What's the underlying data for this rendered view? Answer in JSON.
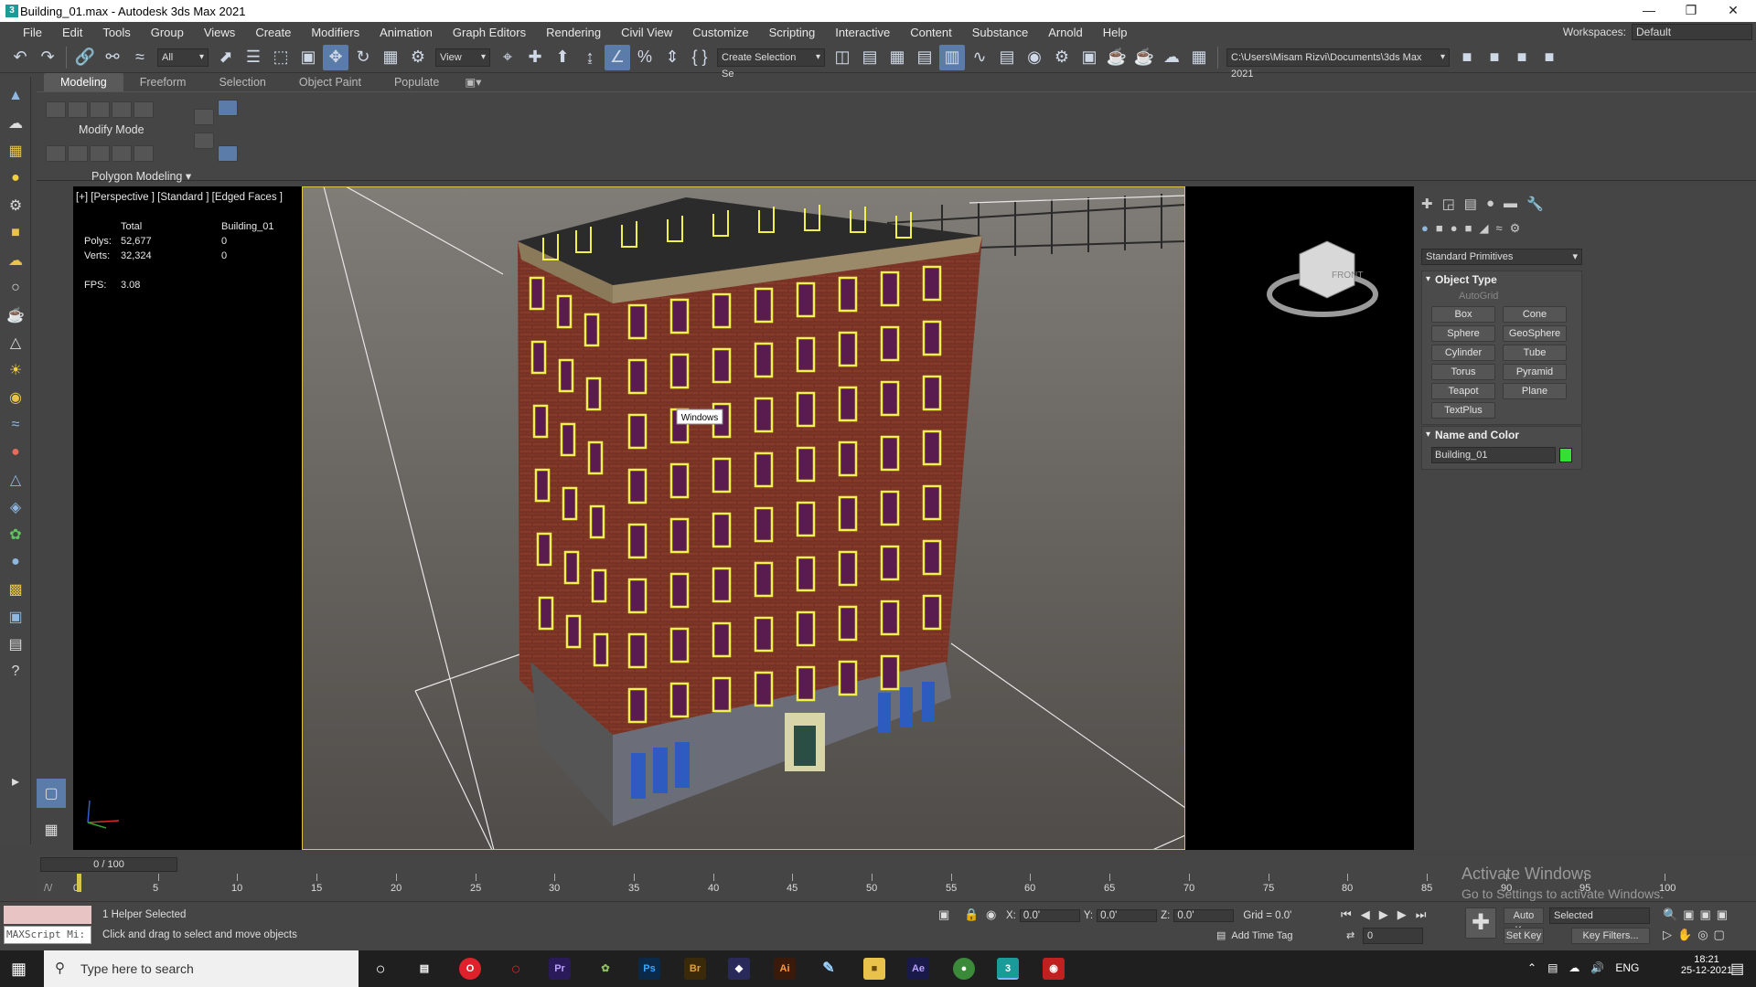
{
  "window": {
    "title": "Building_01.max - Autodesk 3ds Max 2021"
  },
  "menu": [
    "File",
    "Edit",
    "Tools",
    "Group",
    "Views",
    "Create",
    "Modifiers",
    "Animation",
    "Graph Editors",
    "Rendering",
    "Civil View",
    "Customize",
    "Scripting",
    "Interactive",
    "Content",
    "Substance",
    "Arnold",
    "Help"
  ],
  "workspace": {
    "label": "Workspaces:",
    "value": "Default"
  },
  "toolbar": {
    "filter": "All",
    "ref_coord": "View",
    "selection_set": "Create Selection Se",
    "project_path": "C:\\Users\\Misam Rizvi\\Documents\\3ds Max 2021"
  },
  "ribbon": {
    "tabs": [
      "Modeling",
      "Freeform",
      "Selection",
      "Object Paint",
      "Populate"
    ],
    "active_tab": "Modeling",
    "mode_label": "Modify Mode",
    "panel_label": "Polygon Modeling"
  },
  "viewport": {
    "label": "[+] [Perspective ] [Standard ] [Edged Faces ]",
    "stats": {
      "col_total": "Total",
      "col_object": "Building_01",
      "polys_label": "Polys:",
      "polys_total": "52,677",
      "polys_obj": "0",
      "verts_label": "Verts:",
      "verts_total": "32,324",
      "verts_obj": "0",
      "fps_label": "FPS:",
      "fps_value": "3.08"
    },
    "tooltip": "Windows",
    "viewcube_face": "FRONT"
  },
  "command_panel": {
    "category": "Standard Primitives",
    "object_type_header": "Object Type",
    "autogrid": "AutoGrid",
    "buttons": [
      "Box",
      "Cone",
      "Sphere",
      "GeoSphere",
      "Cylinder",
      "Tube",
      "Torus",
      "Pyramid",
      "Teapot",
      "Plane",
      "TextPlus"
    ],
    "name_color_header": "Name and Color",
    "object_name": "Building_01",
    "object_color": "#34e034"
  },
  "timeline": {
    "slider": "0 / 100",
    "ticks": [
      "0",
      "5",
      "10",
      "15",
      "20",
      "25",
      "30",
      "35",
      "40",
      "45",
      "50",
      "55",
      "60",
      "65",
      "70",
      "75",
      "80",
      "85",
      "90",
      "95",
      "100"
    ]
  },
  "status": {
    "selected": "1 Helper Selected",
    "prompt": "Click and drag to select and move objects",
    "maxscript": "MAXScript Mi:",
    "x_label": "X:",
    "x_val": "0.0'",
    "y_label": "Y:",
    "y_val": "0.0'",
    "z_label": "Z:",
    "z_val": "0.0'",
    "grid": "Grid = 0.0'",
    "add_time_tag": "Add Time Tag",
    "auto_key": "Auto Key",
    "set_key": "Set Key",
    "key_mode": "Selected",
    "key_filters": "Key Filters...",
    "frame": "0"
  },
  "watermark": {
    "line1": "Activate Windows",
    "line2": "Go to Settings to activate Windows."
  },
  "taskbar": {
    "search": "Type here to search",
    "lang": "ENG",
    "time": "18:21",
    "date": "25-12-2021"
  }
}
